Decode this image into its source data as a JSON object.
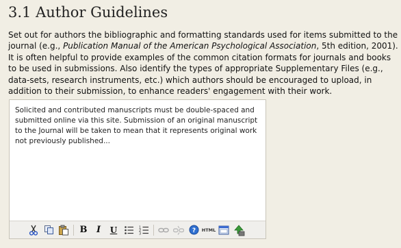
{
  "section": {
    "heading": "3.1 Author Guidelines",
    "desc_before_em": "Set out for authors the bibliographic and formatting standards used for items submitted to the journal (e.g., ",
    "desc_em": "Publication Manual of the American Psychological Association",
    "desc_after_em": ", 5th edition, 2001). It is often helpful to provide examples of the common citation formats for journals and books to be used in submissions. Also identify the types of appropriate Supplementary Files (e.g., data-sets, research instruments, etc.) which authors should be encouraged to upload, in addition to their submission, to enhance readers' engagement with their work."
  },
  "editor": {
    "content": "Solicited and contributed manuscripts must be double-spaced and submitted online via this site. Submission of an original manuscript to the Journal will be taken to mean that it represents original work not previously published..."
  },
  "toolbar": {
    "bold_label": "B",
    "italic_label": "I",
    "underline_label": "U",
    "html_label": "HTML",
    "icons": [
      "cut-icon",
      "copy-icon",
      "paste-icon",
      "bold",
      "italic",
      "underline",
      "bullet-list-icon",
      "numbered-list-icon",
      "link-icon",
      "unlink-icon",
      "help-icon",
      "html-source-icon",
      "fullscreen-icon",
      "upload-image-icon"
    ],
    "colors": {
      "background": "#f1eee4",
      "editor_bg": "#ffffff",
      "toolbar_bg": "#f0efec",
      "help_blue": "#2f6fd0"
    }
  }
}
